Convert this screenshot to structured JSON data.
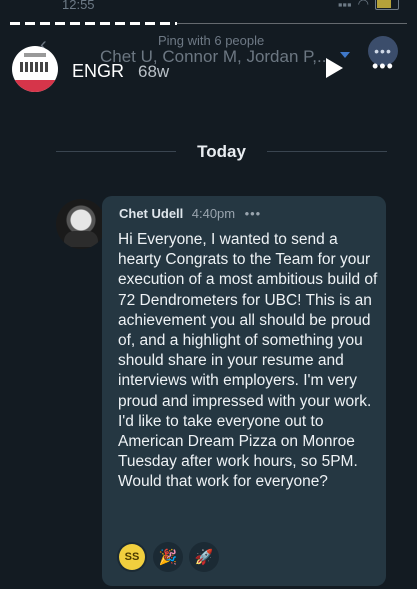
{
  "status_bar": {
    "time": "12:55"
  },
  "header": {
    "ping_text": "Ping with 6 people",
    "members": "Chet U, Connor M, Jordan P,..",
    "more_icon": "ellipsis-icon"
  },
  "story": {
    "name": "ENGR",
    "age": "68w"
  },
  "divider": {
    "label": "Today"
  },
  "message": {
    "author": "Chet Udell",
    "time": "4:40pm",
    "more": "•••",
    "body": "Hi Everyone, I wanted to send a hearty Congrats to the Team for your execution of a most ambitious build of 72 Dendrometers for UBC! This is an achievement you all should be proud of, and a highlight of something you should share in your resume and interviews with employers. I'm very proud and impressed with your work. I'd like to take everyone out to American Dream Pizza on Monroe Tuesday after work hours, so 5PM. Would that work for everyone?",
    "reactions": [
      {
        "type": "avatar",
        "initials": "SS"
      },
      {
        "type": "emoji",
        "glyph": "🎉"
      },
      {
        "type": "emoji",
        "glyph": "🚀"
      }
    ]
  },
  "colors": {
    "background": "#131b22",
    "bubble": "#253742",
    "accent": "#3f78c9"
  }
}
